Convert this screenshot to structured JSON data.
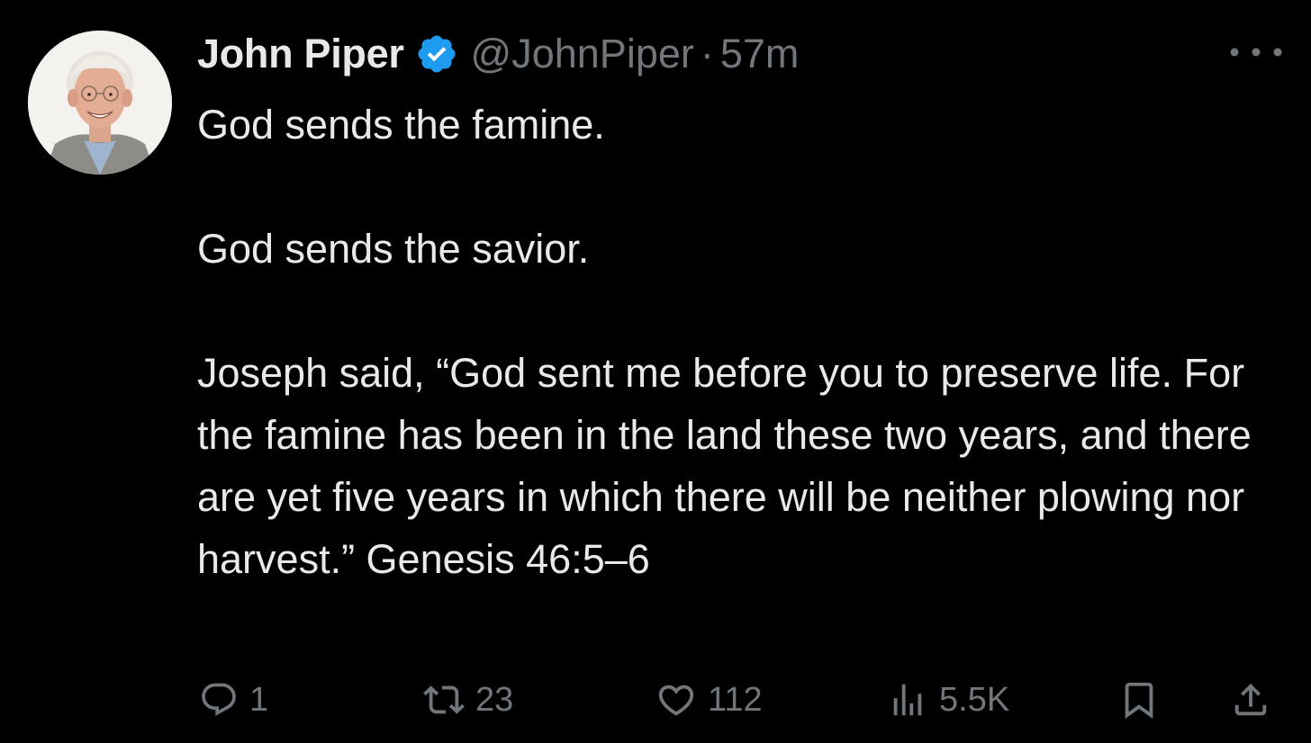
{
  "author": {
    "display_name": "John Piper",
    "handle": "@JohnPiper",
    "separator": "·",
    "time": "57m",
    "verified": true
  },
  "tweet": {
    "paragraphs": [
      "God sends the famine.",
      "God sends the savior.",
      "Joseph said, “God sent me before you to preserve life. For the famine has been in the land these two years, and there are yet five years in which there will be neither plowing nor harvest.” Genesis 46:5–6"
    ]
  },
  "actions": {
    "reply_count": "1",
    "retweet_count": "23",
    "like_count": "112",
    "views_count": "5.5K"
  },
  "icons": {
    "verified": "verified-badge-icon",
    "more": "more-dots-icon",
    "reply": "reply-icon",
    "retweet": "retweet-icon",
    "like": "heart-icon",
    "views": "views-chart-icon",
    "bookmark": "bookmark-icon",
    "share": "share-icon"
  },
  "colors": {
    "background": "#000000",
    "text": "#e7e9ea",
    "muted": "#71767b",
    "verified": "#1d9bf0"
  }
}
